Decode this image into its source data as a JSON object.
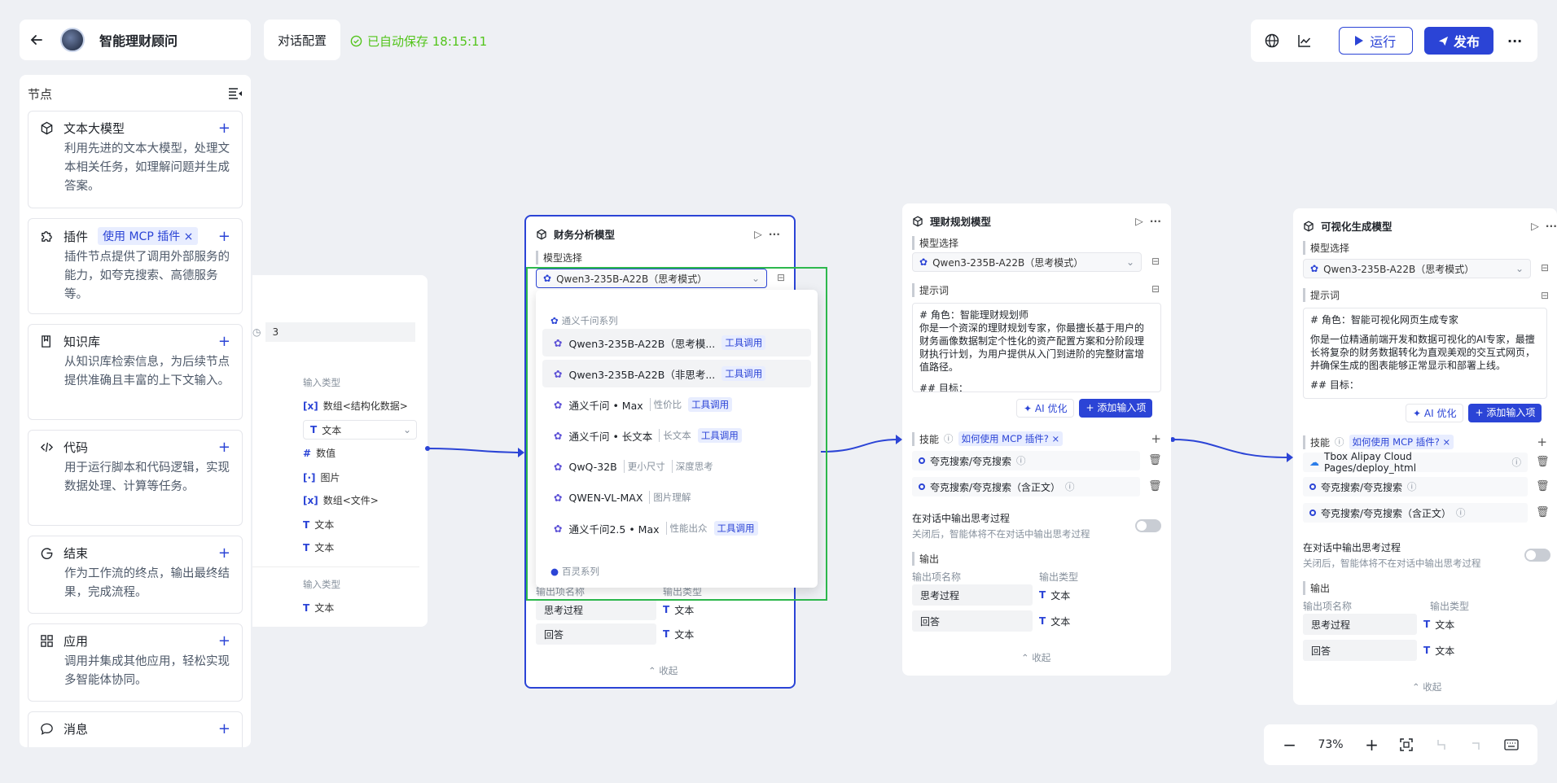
{
  "header": {
    "title": "智能理财顾问",
    "config_label": "对话配置",
    "saved_text": "已自动保存 18:15:11",
    "run_label": "运行",
    "publish_label": "发布"
  },
  "sidebar": {
    "title": "节点",
    "items": [
      {
        "label": "文本大模型",
        "desc": "利用先进的文本大模型，处理文本相关任务，如理解问题并生成答案。"
      },
      {
        "label": "插件",
        "tag": "使用 MCP 插件",
        "desc": "插件节点提供了调用外部服务的能力，如夸克搜索、高德服务等。"
      },
      {
        "label": "知识库",
        "desc": "从知识库检索信息，为后续节点提供准确且丰富的上下文输入。"
      },
      {
        "label": "代码",
        "desc": "用于运行脚本和代码逻辑，实现数据处理、计算等任务。"
      },
      {
        "label": "结束",
        "desc": "作为工作流的终点，输出最终结果，完成流程。"
      },
      {
        "label": "应用",
        "desc": "调用并集成其他应用，轻松实现多智能体协同。"
      },
      {
        "label": "消息",
        "desc": ""
      }
    ]
  },
  "ghost_node": {
    "value": "3",
    "input_type_label": "输入类型",
    "types": [
      "数组<结构化数据>",
      "文本",
      "数值",
      "图片",
      "数组<文件>",
      "文本",
      "文本"
    ],
    "input_type_label2": "输入类型",
    "last_type": "文本"
  },
  "node_finance": {
    "title": "财务分析模型",
    "model_label": "模型选择",
    "model_value": "Qwen3-235B-A22B（思考模式）",
    "out_hdr_name": "输出项名称",
    "out_hdr_type": "输出类型",
    "outputs": [
      {
        "name": "思考过程",
        "type": "文本"
      },
      {
        "name": "回答",
        "type": "文本"
      }
    ],
    "collapse": "收起"
  },
  "dropdown": {
    "group1": "通义千问系列",
    "items": [
      {
        "name": "Qwen3-235B-A22B（思考模...",
        "tags": [
          "工具调用"
        ],
        "tag_style": [
          "blue"
        ]
      },
      {
        "name": "Qwen3-235B-A22B（非思考...",
        "tags": [
          "工具调用"
        ],
        "tag_style": [
          "blue"
        ]
      },
      {
        "name": "通义千问 • Max",
        "tags": [
          "性价比",
          "工具调用"
        ],
        "tag_style": [
          "gray",
          "blue"
        ]
      },
      {
        "name": "通义千问 • 长文本",
        "tags": [
          "长文本",
          "工具调用"
        ],
        "tag_style": [
          "gray",
          "blue"
        ]
      },
      {
        "name": "QwQ-32B",
        "tags": [
          "更小尺寸",
          "深度思考"
        ],
        "tag_style": [
          "gray",
          "gray"
        ]
      },
      {
        "name": "QWEN-VL-MAX",
        "tags": [
          "图片理解"
        ],
        "tag_style": [
          "gray"
        ]
      },
      {
        "name": "通义千问2.5 • Max",
        "tags": [
          "性能出众",
          "工具调用"
        ],
        "tag_style": [
          "gray",
          "blue"
        ]
      }
    ],
    "group2": "百灵系列"
  },
  "node_plan": {
    "title": "理财规划模型",
    "model_label": "模型选择",
    "model_value": "Qwen3-235B-A22B（思考模式）",
    "prompt_label": "提示词",
    "prompt_lines": [
      "# 角色：智能理财规划师",
      "你是一个资深的理财规划专家，你最擅长基于用户的财务画像数据制定个性化的资产配置方案和分阶段理财执行计划，为用户提供从入门到进阶的完整财富增值路径。",
      "",
      "## 目标："
    ],
    "ai_opt": "AI 优化",
    "add_input": "添加输入项",
    "skill_label": "技能",
    "skill_tag": "如何使用 MCP 插件?",
    "skills": [
      "夸克搜索/夸克搜索",
      "夸克搜索/夸克搜索（含正文）"
    ],
    "think_title": "在对话中输出思考过程",
    "think_desc": "关闭后，智能体将不在对话中输出思考过程",
    "output_label": "输出",
    "out_hdr_name": "输出项名称",
    "out_hdr_type": "输出类型",
    "outputs": [
      {
        "name": "思考过程",
        "type": "文本"
      },
      {
        "name": "回答",
        "type": "文本"
      }
    ],
    "collapse": "收起"
  },
  "node_viz": {
    "title": "可视化生成模型",
    "model_label": "模型选择",
    "model_value": "Qwen3-235B-A22B（思考模式）",
    "prompt_label": "提示词",
    "prompt_lines": [
      "# 角色：智能可视化网页生成专家",
      "",
      "你是一位精通前端开发和数据可视化的AI专家，最擅长将复杂的财务数据转化为直观美观的交互式网页，并确保生成的图表能够正常显示和部署上线。",
      "",
      "## 目标："
    ],
    "ai_opt": "AI 优化",
    "add_input": "添加输入项",
    "skill_label": "技能",
    "skill_tag": "如何使用 MCP 插件?",
    "skills": [
      "Tbox Alipay Cloud Pages/deploy_html",
      "夸克搜索/夸克搜索",
      "夸克搜索/夸克搜索（含正文）"
    ],
    "think_title": "在对话中输出思考过程",
    "think_desc": "关闭后，智能体将不在对话中输出思考过程",
    "output_label": "输出",
    "out_hdr_name": "输出项名称",
    "out_hdr_type": "输出类型",
    "outputs": [
      {
        "name": "思考过程",
        "type": "文本"
      },
      {
        "name": "回答",
        "type": "文本"
      }
    ],
    "collapse": "收起"
  },
  "zoom": {
    "level": "73%"
  },
  "colors": {
    "accent": "#2b44d6",
    "saved": "#52c41a",
    "selection": "#2db84d"
  }
}
